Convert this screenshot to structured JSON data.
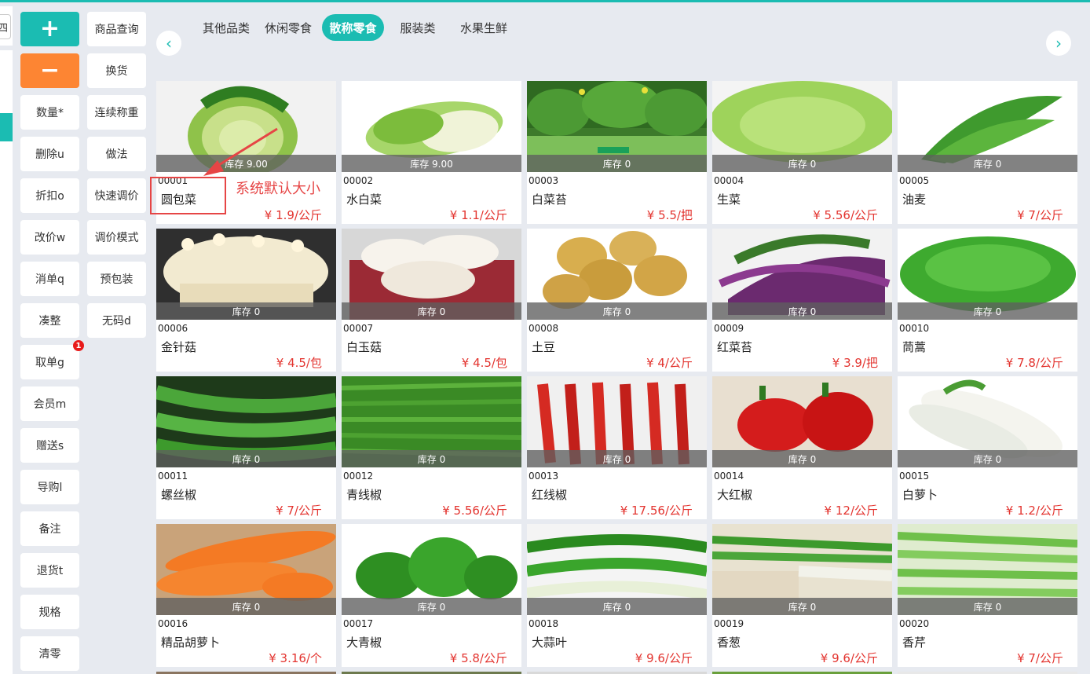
{
  "colors": {
    "accent": "#1bbcb2",
    "minus": "#fd8533",
    "price": "#e3342f",
    "annotation": "#e64545"
  },
  "edge": {
    "icon": "window-icon",
    "label": "四"
  },
  "actions": {
    "plus_icon": "plus-icon",
    "minus_icon": "minus-icon",
    "col1": [
      "数量*",
      "删除u",
      "折扣o",
      "改价w",
      "消单q",
      "凑整",
      "取单g",
      "会员m",
      "赠送s",
      "导购l",
      "备注",
      "退货t",
      "规格",
      "清零"
    ],
    "col2": [
      "商品查询",
      "换货",
      "连续称重",
      "做法",
      "快速调价",
      "调价模式",
      "预包装",
      "无码d"
    ],
    "badge": "1"
  },
  "tabs": {
    "items": [
      "其他品类",
      "休闲零食",
      "散称零食",
      "服装类",
      "水果生鲜"
    ],
    "active_index": 2
  },
  "nav": {
    "prev_icon": "chevron-left-icon",
    "next_icon": "chevron-right-icon"
  },
  "annotation": {
    "text": "系统默认大小"
  },
  "products": [
    {
      "code": "00001",
      "name": "圆包菜",
      "price": "¥ 1.9/公斤",
      "stock": "库存 9.00",
      "img": "cabbage"
    },
    {
      "code": "00002",
      "name": "水白菜",
      "price": "¥ 1.1/公斤",
      "stock": "库存 9.00",
      "img": "napa"
    },
    {
      "code": "00003",
      "name": "白菜苔",
      "price": "¥ 5.5/把",
      "stock": "库存 0",
      "img": "greens"
    },
    {
      "code": "00004",
      "name": "生菜",
      "price": "¥ 5.56/公斤",
      "stock": "库存 0",
      "img": "lettuce"
    },
    {
      "code": "00005",
      "name": "油麦",
      "price": "¥ 7/公斤",
      "stock": "库存 0",
      "img": "leafy"
    },
    {
      "code": "00006",
      "name": "金针菇",
      "price": "¥ 4.5/包",
      "stock": "库存 0",
      "img": "enoki"
    },
    {
      "code": "00007",
      "name": "白玉菇",
      "price": "¥ 4.5/包",
      "stock": "库存 0",
      "img": "mushroom"
    },
    {
      "code": "00008",
      "name": "土豆",
      "price": "¥ 4/公斤",
      "stock": "库存 0",
      "img": "potato"
    },
    {
      "code": "00009",
      "name": "红菜苔",
      "price": "¥ 3.9/把",
      "stock": "库存 0",
      "img": "purple"
    },
    {
      "code": "00010",
      "name": "茼蒿",
      "price": "¥ 7.8/公斤",
      "stock": "库存 0",
      "img": "leafy2"
    },
    {
      "code": "00011",
      "name": "螺丝椒",
      "price": "¥ 7/公斤",
      "stock": "库存 0",
      "img": "greenpepper"
    },
    {
      "code": "00012",
      "name": "青线椒",
      "price": "¥ 5.56/公斤",
      "stock": "库存 0",
      "img": "greenbeans"
    },
    {
      "code": "00013",
      "name": "红线椒",
      "price": "¥ 17.56/公斤",
      "stock": "库存 0",
      "img": "redchili"
    },
    {
      "code": "00014",
      "name": "大红椒",
      "price": "¥ 12/公斤",
      "stock": "库存 0",
      "img": "redpepper"
    },
    {
      "code": "00015",
      "name": "白萝卜",
      "price": "¥ 1.2/公斤",
      "stock": "库存 0",
      "img": "radish"
    },
    {
      "code": "00016",
      "name": "精品胡萝卜",
      "price": "¥ 3.16/个",
      "stock": "库存 0",
      "img": "carrot"
    },
    {
      "code": "00017",
      "name": "大青椒",
      "price": "¥ 5.8/公斤",
      "stock": "库存 0",
      "img": "bellpepper"
    },
    {
      "code": "00018",
      "name": "大蒜叶",
      "price": "¥ 9.6/公斤",
      "stock": "库存 0",
      "img": "garlic"
    },
    {
      "code": "00019",
      "name": "香葱",
      "price": "¥ 9.6/公斤",
      "stock": "库存 0",
      "img": "scallion"
    },
    {
      "code": "00020",
      "name": "香芹",
      "price": "¥ 7/公斤",
      "stock": "库存 0",
      "img": "celery"
    }
  ]
}
